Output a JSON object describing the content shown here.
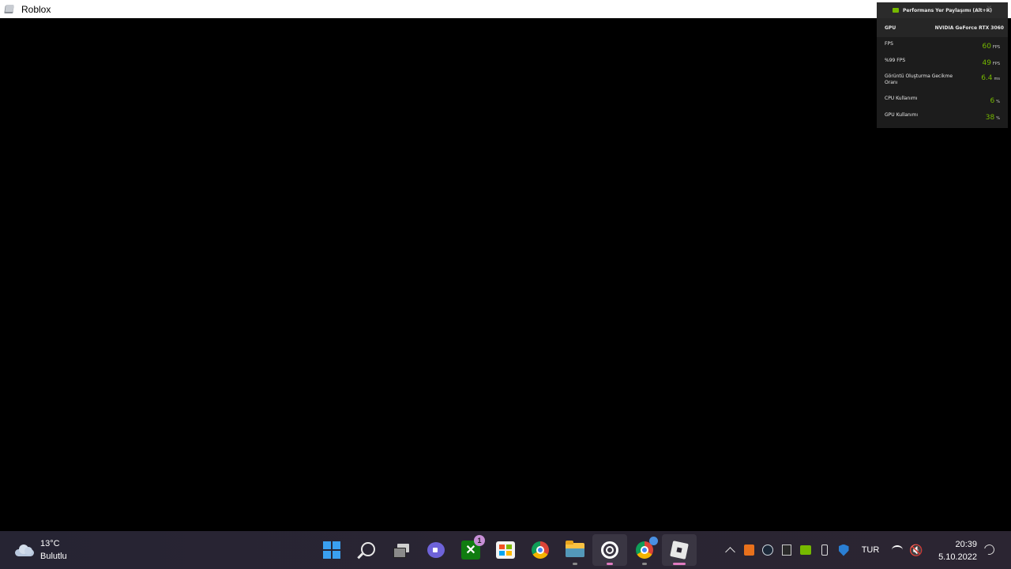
{
  "window": {
    "title": "Roblox"
  },
  "overlay": {
    "header": "Performans Yer Paylaşımı (Alt+R)",
    "gpu": {
      "label": "GPU",
      "value": "NVIDIA GeForce RTX 3060"
    },
    "rows": [
      {
        "label": "FPS",
        "value": "60",
        "unit": "FPS"
      },
      {
        "label": "%99 FPS",
        "value": "49",
        "unit": "FPS"
      },
      {
        "label": "Görüntü Oluşturma Gecikme Oranı",
        "value": "6.4",
        "unit": "ms"
      },
      {
        "label": "CPU Kullanımı",
        "value": "6",
        "unit": "%"
      },
      {
        "label": "GPU Kullanımı",
        "value": "38",
        "unit": "%"
      }
    ],
    "accent_color": "#76b900"
  },
  "taskbar": {
    "weather": {
      "temp": "13°C",
      "condition": "Bulutlu"
    },
    "apps": [
      {
        "name": "start",
        "icon": "windows-icon"
      },
      {
        "name": "search",
        "icon": "search-icon"
      },
      {
        "name": "task-view",
        "icon": "task-view-icon"
      },
      {
        "name": "teams-chat",
        "icon": "chat-icon"
      },
      {
        "name": "xbox",
        "icon": "xbox-icon",
        "badge": "1"
      },
      {
        "name": "microsoft-store",
        "icon": "store-icon"
      },
      {
        "name": "chrome",
        "icon": "chrome-icon"
      },
      {
        "name": "file-explorer",
        "icon": "folder-icon"
      },
      {
        "name": "ubisoft-connect",
        "icon": "ubisoft-icon"
      },
      {
        "name": "chrome-profile",
        "icon": "chrome-icon"
      },
      {
        "name": "roblox",
        "icon": "roblox-icon"
      }
    ],
    "tray": {
      "language": "TUR",
      "time": "20:39",
      "date": "5.10.2022"
    }
  }
}
